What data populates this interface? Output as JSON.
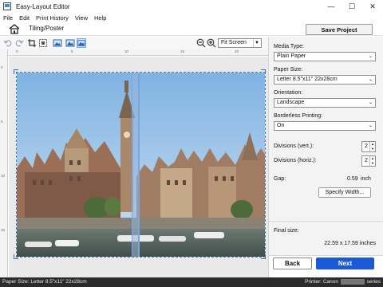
{
  "window": {
    "title": "Easy-Layout Editor"
  },
  "menu": [
    "File",
    "Edit",
    "Print History",
    "View",
    "Help"
  ],
  "header": {
    "tab_label": "Tiling/Poster",
    "save_label": "Save Project"
  },
  "toolbar": {
    "zoom_value": "Fit Screen"
  },
  "ruler": {
    "top": [
      "0",
      "5",
      "10",
      "15",
      "20"
    ],
    "left": [
      "0",
      "5",
      "10",
      "15"
    ]
  },
  "panel": {
    "media_type_label": "Media Type:",
    "media_type_value": "Plain Paper",
    "paper_size_label": "Paper Size:",
    "paper_size_value": "Letter 8.5\"x11\" 22x28cm",
    "orientation_label": "Orientation:",
    "orientation_value": "Landscape",
    "borderless_label": "Borderless Printing:",
    "borderless_value": "On",
    "div_vert_label": "Divisions (vert.):",
    "div_vert_value": "2",
    "div_horiz_label": "Divisions (horiz.):",
    "div_horiz_value": "2",
    "gap_label": "Gap:",
    "gap_value": "0.59",
    "gap_unit": "inch",
    "specify_width_label": "Specify Width...",
    "final_size_label": "Final size:",
    "final_size_value": "22.59 x 17.59 inches"
  },
  "footer": {
    "back_label": "Back",
    "next_label": "Next"
  },
  "statusbar": {
    "paper_size": "Paper Size: Letter 8.5\"x11\" 22x28cm",
    "printer_prefix": "Printer: Canon",
    "printer_suffix": "series"
  },
  "colors": {
    "accent": "#1a5ad7",
    "status_bg": "#2b2b2b"
  }
}
